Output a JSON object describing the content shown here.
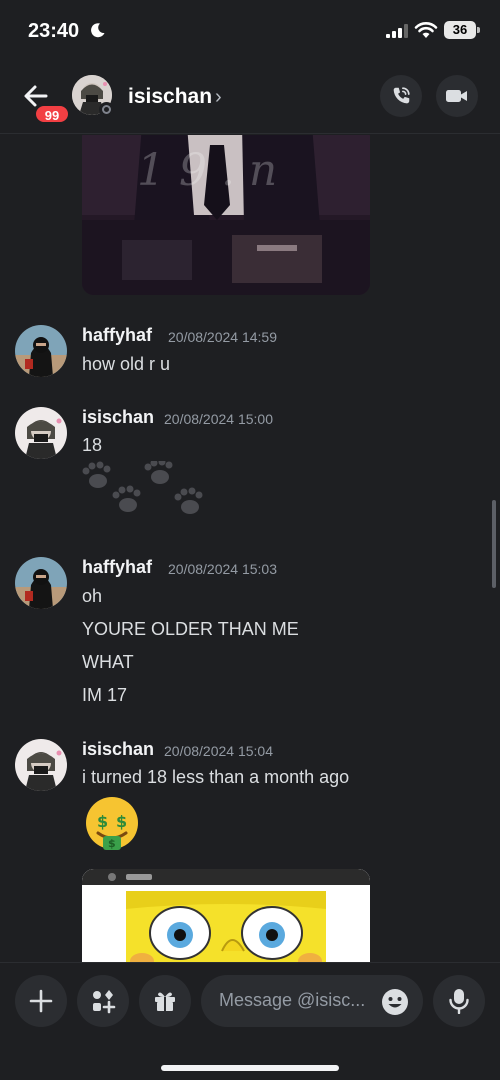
{
  "status_bar": {
    "time": "23:40",
    "battery": "36"
  },
  "header": {
    "unread_badge": "99",
    "name": "isischan",
    "chevron": "›"
  },
  "messages": [
    {
      "author": "haffyhaf",
      "timestamp": "20/08/2024 14:59",
      "lines": [
        "how old r u"
      ]
    },
    {
      "author": "isischan",
      "timestamp": "20/08/2024 15:00",
      "lines": [
        "18"
      ]
    },
    {
      "author": "haffyhaf",
      "timestamp": "20/08/2024 15:03",
      "lines": [
        "oh",
        "YOURE OLDER THAN ME",
        "WHAT",
        "IM 17"
      ]
    },
    {
      "author": "isischan",
      "timestamp": "20/08/2024 15:04",
      "lines": [
        "i turned 18 less than a month ago"
      ]
    }
  ],
  "composer": {
    "placeholder": "Message @isisc..."
  },
  "colors": {
    "background": "#1e1f22",
    "surface": "#2b2d31",
    "badge": "#f23f43",
    "muted": "#949ba4"
  }
}
